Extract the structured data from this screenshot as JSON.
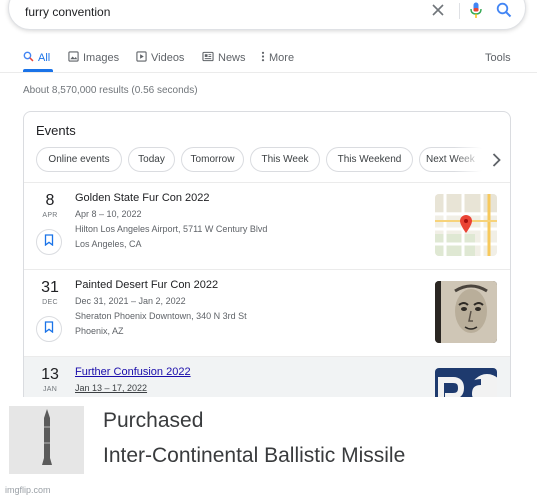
{
  "search": {
    "query": "furry convention"
  },
  "icons": {
    "clear": "close-icon",
    "voice": "mic-icon",
    "search": "search-icon"
  },
  "tabs": [
    {
      "label": "All",
      "icon": "search-icon",
      "active": true
    },
    {
      "label": "Images",
      "icon": "image-icon",
      "active": false
    },
    {
      "label": "Videos",
      "icon": "play-icon",
      "active": false
    },
    {
      "label": "News",
      "icon": "news-icon",
      "active": false
    },
    {
      "label": "More",
      "icon": "more-vert-icon",
      "active": false
    }
  ],
  "tools_label": "Tools",
  "result_stats": "About 8,570,000 results (0.56 seconds)",
  "events_card": {
    "title": "Events",
    "chips": [
      "Online events",
      "Today",
      "Tomorrow",
      "This Week",
      "This Weekend",
      "Next Week"
    ],
    "events": [
      {
        "day": "8",
        "month": "APR",
        "title": "Golden State Fur Con 2022",
        "dates": "Apr 8 – 10, 2022",
        "venue": "Hilton Los Angeles Airport, 5711 W Century Blvd",
        "city": "Los Angeles, CA",
        "thumb": "map-thumbnail"
      },
      {
        "day": "31",
        "month": "DEC",
        "title": "Painted Desert Fur Con 2022",
        "dates": "Dec 31, 2021 – Jan 2, 2022",
        "venue": "Sheraton Phoenix Downtown, 340 N 3rd St",
        "city": "Phoenix, AZ",
        "thumb": "portrait-thumbnail"
      },
      {
        "day": "13",
        "month": "JAN",
        "title": "Further Confusion 2022",
        "dates": "Jan 13 – 17, 2022",
        "thumb": "logo-thumbnail"
      }
    ]
  },
  "purchase_overlay": {
    "heading": "Purchased",
    "item": "Inter-Continental Ballistic Missile",
    "icon": "missile-icon"
  },
  "watermark": "imgflip.com",
  "colors": {
    "link_blue": "#1a73e8",
    "text": "#202124",
    "muted": "#70757a",
    "border": "#dadce0",
    "map_pin": "#ea4335"
  }
}
